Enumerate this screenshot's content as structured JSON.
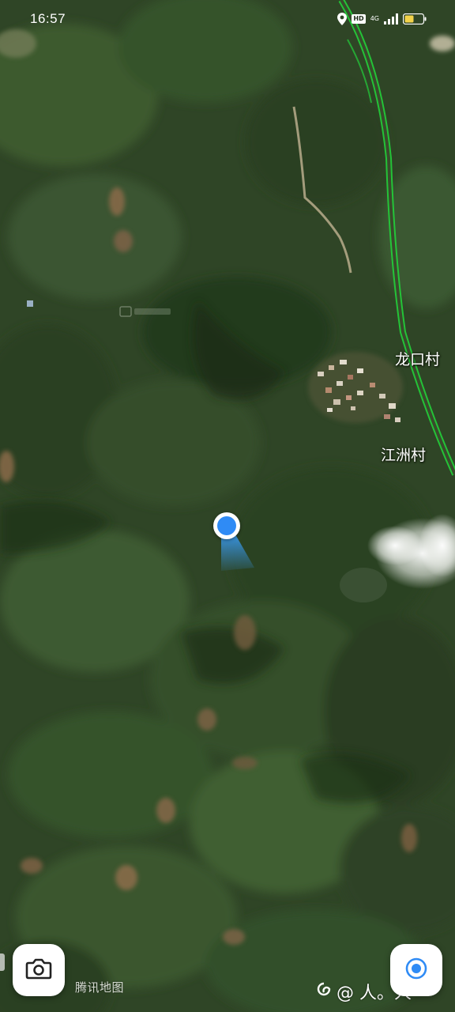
{
  "status_bar": {
    "time": "16:57",
    "hd_badge": "HD",
    "network": "4G",
    "icons": [
      "location-icon",
      "signal-icon",
      "battery-icon"
    ],
    "battery_fraction": 0.5
  },
  "map": {
    "type": "satellite",
    "place_labels": [
      "龙口村",
      "江洲村"
    ],
    "colors": {
      "road_border": "#22d03a",
      "location_accent": "#2f8bf5",
      "label_text": "#ffffff"
    }
  },
  "controls": {
    "camera_button_icon": "camera-icon",
    "locate_button_icon": "locate-icon",
    "logo_text": "腾讯地图"
  },
  "watermark": {
    "text": "@ 人。人"
  }
}
